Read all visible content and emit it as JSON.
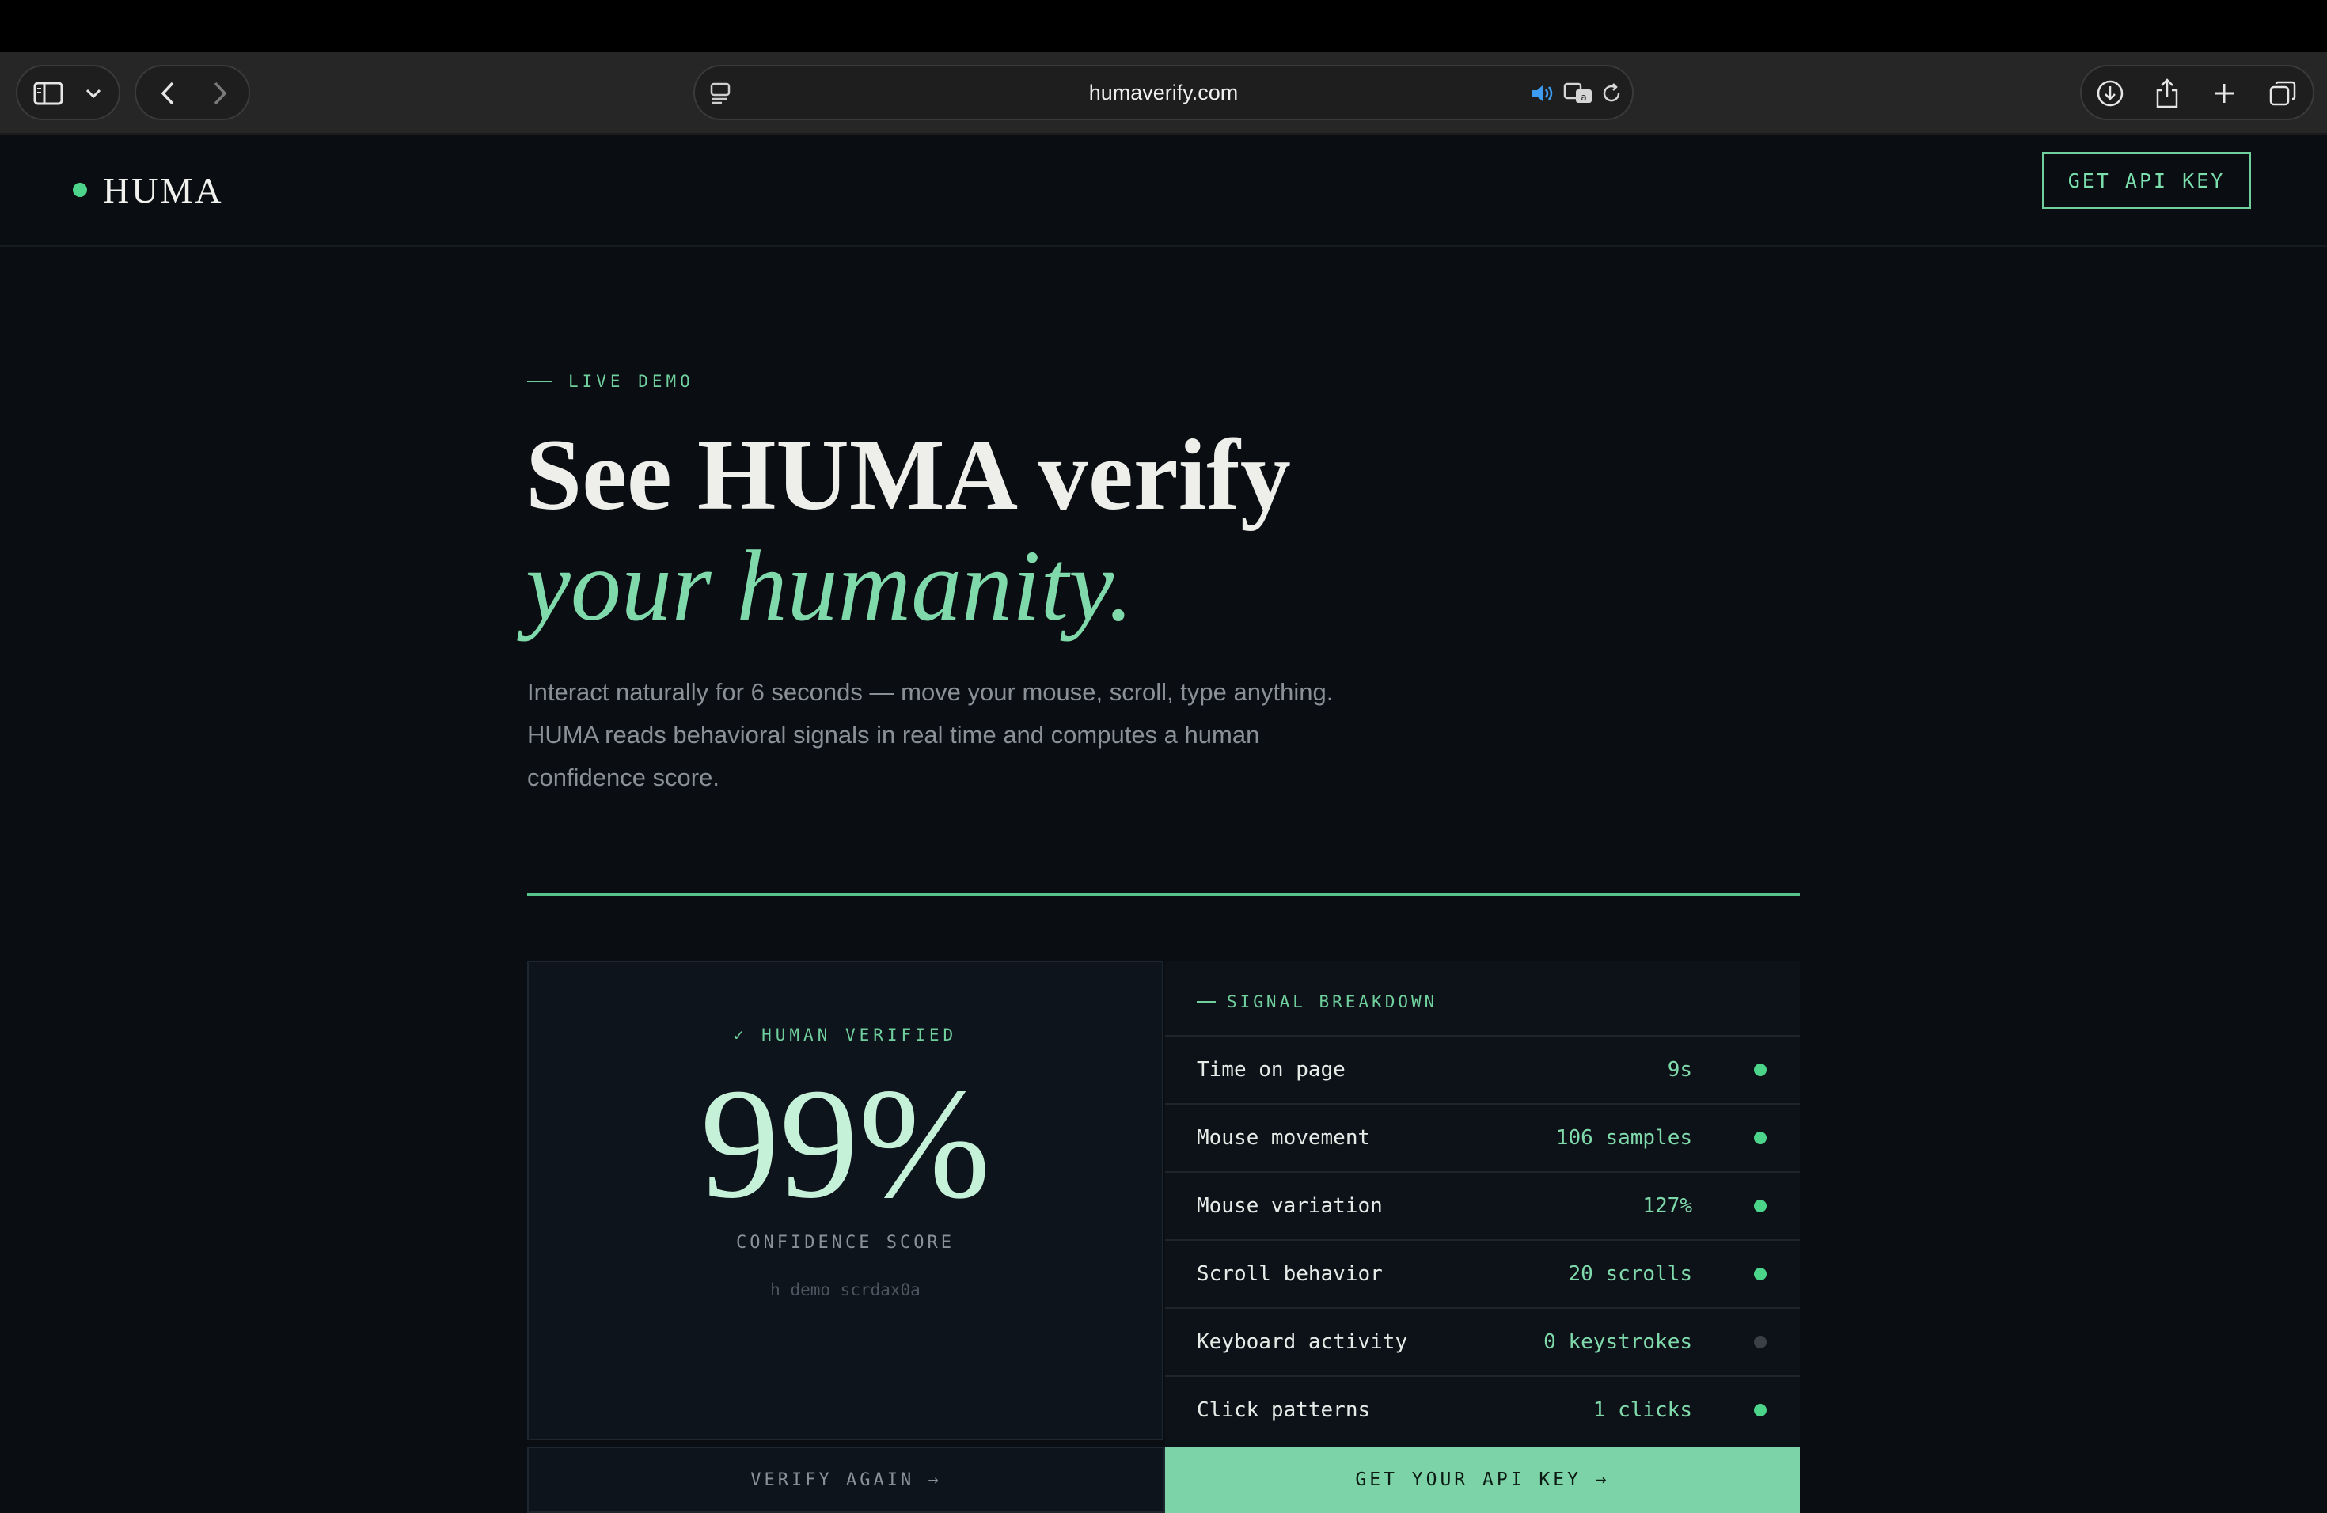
{
  "browser": {
    "url": "humaverify.com",
    "icons": [
      "sidebar-icon",
      "chevron-down-icon",
      "back-icon",
      "forward-icon",
      "reader-icon",
      "speaker-icon",
      "translate-icon",
      "reload-icon",
      "download-icon",
      "share-icon",
      "new-tab-icon",
      "tabs-overview-icon"
    ]
  },
  "nav": {
    "brand": "HUMA",
    "cta": "GET API KEY"
  },
  "hero": {
    "eyebrow": "LIVE DEMO",
    "headline": "See HUMA verify",
    "headline_accent": "your humanity.",
    "subtext": "Interact naturally for 6 seconds — move your mouse, scroll, type anything. HUMA reads behavioral signals in real time and computes a human confidence score."
  },
  "result": {
    "status": "✓ HUMAN VERIFIED",
    "score": "99%",
    "score_label": "CONFIDENCE SCORE",
    "session_id": "h_demo_scrdax0a"
  },
  "signals": {
    "title": "SIGNAL BREAKDOWN",
    "rows": [
      {
        "label": "Time on page",
        "value": "9s",
        "active": true
      },
      {
        "label": "Mouse movement",
        "value": "106 samples",
        "active": true
      },
      {
        "label": "Mouse variation",
        "value": "127%",
        "active": true
      },
      {
        "label": "Scroll behavior",
        "value": "20 scrolls",
        "active": true
      },
      {
        "label": "Keyboard activity",
        "value": "0 keystrokes",
        "active": false
      },
      {
        "label": "Click patterns",
        "value": "1 clicks",
        "active": true
      }
    ]
  },
  "actions": {
    "verify_again": "VERIFY AGAIN →",
    "get_key": "GET YOUR API KEY →"
  },
  "colors": {
    "accent": "#6fcf9d",
    "accent_fill": "#7cd3a8",
    "background": "#0a0d12",
    "inactive_dot": "#3a4048"
  }
}
